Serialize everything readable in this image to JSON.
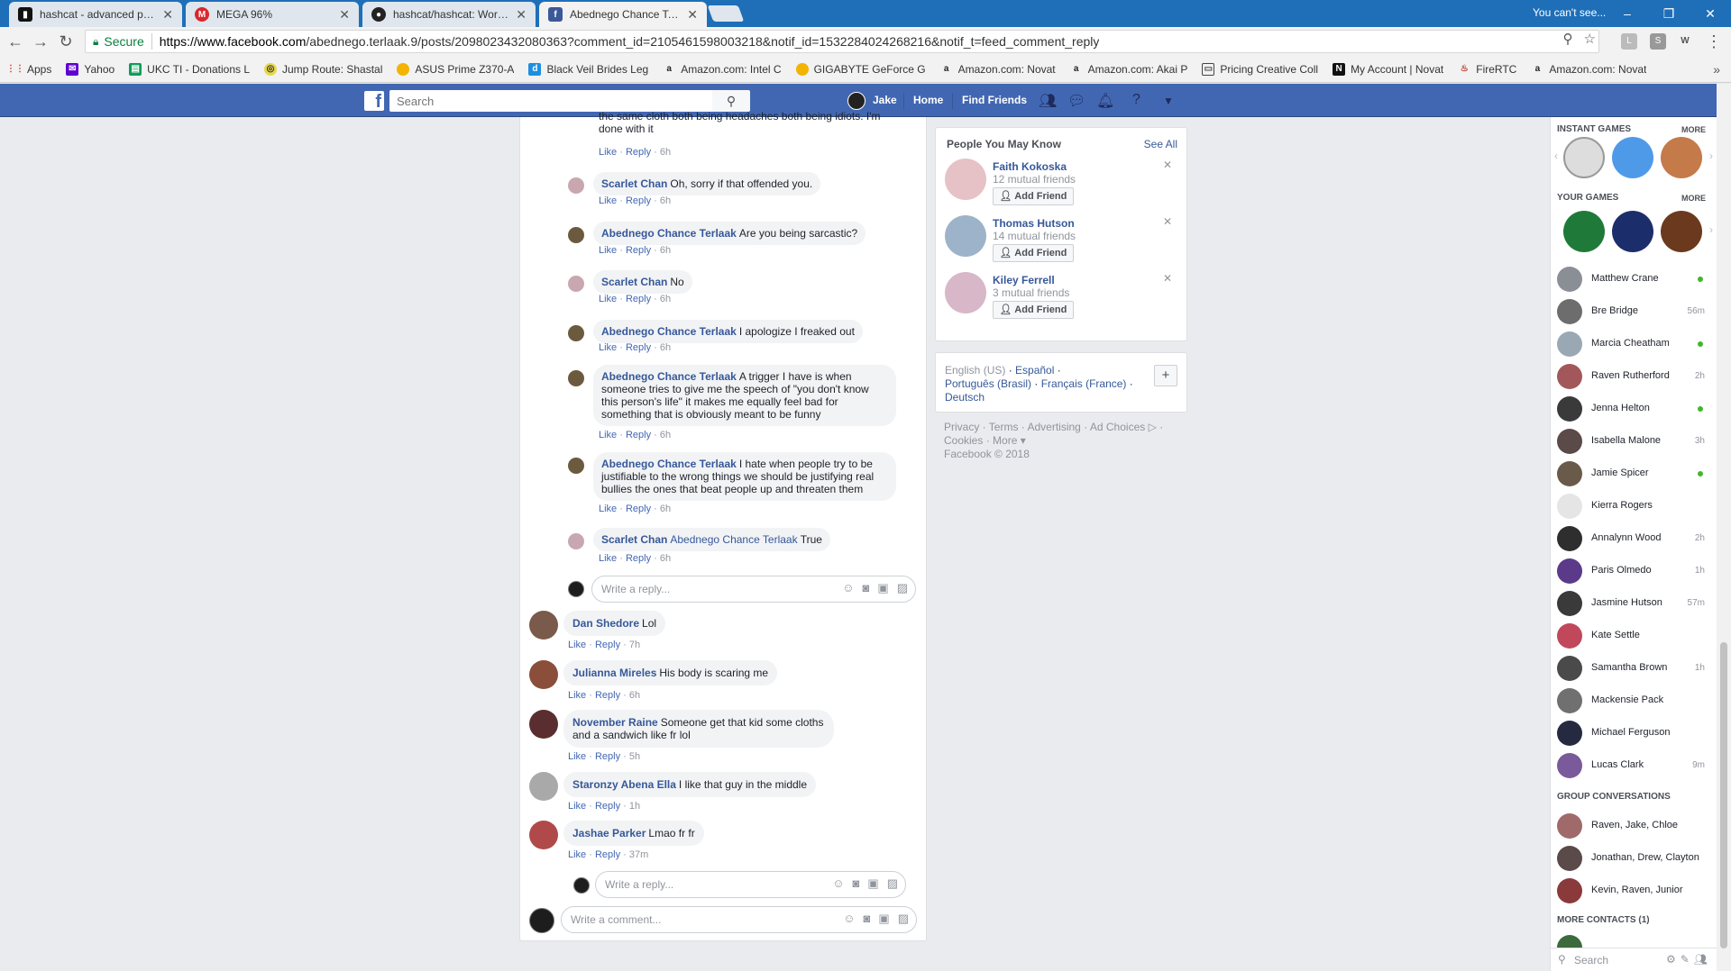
{
  "browser": {
    "tabs": [
      {
        "title": "hashcat - advanced passw",
        "favicon": "hashcat-icon",
        "active": false
      },
      {
        "title": "MEGA 96%",
        "favicon": "mega-icon",
        "active": false
      },
      {
        "title": "hashcat/hashcat: World's",
        "favicon": "github-icon",
        "active": false
      },
      {
        "title": "Abednego Chance Terlaa",
        "favicon": "facebook-icon",
        "active": true
      }
    ],
    "profile_label": "You can't see...",
    "secure_label": "Secure",
    "url_host": "https://www.facebook.com",
    "url_path": "/abednego.terlaak.9/posts/2098023432080363?comment_id=2105461598003218&notif_id=1532284024268216&notif_t=feed_comment_reply",
    "bookmarks": [
      {
        "label": "Apps",
        "icon": "apps-grid-icon",
        "color": "#d93025"
      },
      {
        "label": "Yahoo",
        "icon": "mail-icon",
        "color": "#6001d2"
      },
      {
        "label": "UKC TI - Donations L",
        "icon": "sheet-icon",
        "color": "#0f9d58"
      },
      {
        "label": "Jump Route: Shastal",
        "icon": "route-icon",
        "color": "#b5a600"
      },
      {
        "label": "ASUS Prime Z370-A",
        "icon": "coin-icon",
        "color": "#f2b400"
      },
      {
        "label": "Black Veil Brides Leg",
        "icon": "d-icon",
        "color": "#1d8fe1"
      },
      {
        "label": "Amazon.com: Intel C",
        "icon": "amazon-icon",
        "color": "#222222"
      },
      {
        "label": "GIGABYTE GeForce G",
        "icon": "coin-icon",
        "color": "#f2b400"
      },
      {
        "label": "Amazon.com: Novat",
        "icon": "amazon-icon",
        "color": "#222222"
      },
      {
        "label": "Amazon.com: Akai P",
        "icon": "amazon-icon",
        "color": "#222222"
      },
      {
        "label": "Pricing Creative Coll",
        "icon": "card-icon",
        "color": "#444444"
      },
      {
        "label": "My Account | Novat",
        "icon": "novatel-icon",
        "color": "#111111"
      },
      {
        "label": "FireRTC",
        "icon": "fire-icon",
        "color": "#c0392b"
      },
      {
        "label": "Amazon.com: Novat",
        "icon": "amazon-icon",
        "color": "#222222"
      }
    ]
  },
  "fb": {
    "search_placeholder": "Search",
    "user_name": "Jake",
    "nav_home": "Home",
    "nav_find_friends": "Find Friends"
  },
  "thread": {
    "truncated_text": "the same cloth both being headaches both being idiots. I'm done with it",
    "truncated_actions": {
      "like": "Like",
      "reply": "Reply",
      "time": "6h"
    },
    "replies": [
      {
        "author": "Scarlet Chan",
        "text": "Oh, sorry if that offended you.",
        "like": "Like",
        "reply": "Reply",
        "time": "6h"
      },
      {
        "author": "Abednego Chance Terlaak",
        "text": "Are you being sarcastic?",
        "like": "Like",
        "reply": "Reply",
        "time": "6h"
      },
      {
        "author": "Scarlet Chan",
        "text": "No",
        "like": "Like",
        "reply": "Reply",
        "time": "6h"
      },
      {
        "author": "Abednego Chance Terlaak",
        "text": "I apologize I freaked out",
        "like": "Like",
        "reply": "Reply",
        "time": "6h"
      },
      {
        "author": "Abednego Chance Terlaak",
        "text": "A trigger I have is when someone tries to give me the speech of \"you don't know this person's life\" it makes me equally feel bad for something that is obviously meant to be funny",
        "like": "Like",
        "reply": "Reply",
        "time": "6h"
      },
      {
        "author": "Abednego Chance Terlaak",
        "text": "I hate when people try to be justifiable to the wrong things we should be justifying real bullies the ones that beat people up and threaten them",
        "like": "Like",
        "reply": "Reply",
        "time": "6h"
      },
      {
        "author": "Scarlet Chan",
        "mention": "Abednego Chance Terlaak",
        "text": "True",
        "like": "Like",
        "reply": "Reply",
        "time": "6h"
      }
    ],
    "reply_placeholder": "Write a reply...",
    "comments": [
      {
        "author": "Dan Shedore",
        "text": "Lol",
        "like": "Like",
        "reply": "Reply",
        "time": "7h"
      },
      {
        "author": "Julianna Mireles",
        "text": "His body is scaring me",
        "like": "Like",
        "reply": "Reply",
        "time": "6h"
      },
      {
        "author": "November Raine",
        "text": "Someone get that kid some cloths and a sandwich like fr lol",
        "like": "Like",
        "reply": "Reply",
        "time": "5h"
      },
      {
        "author": "Staronzy Abena Ella",
        "text": "I like that guy in the middle",
        "like": "Like",
        "reply": "Reply",
        "time": "1h"
      },
      {
        "author": "Jashae Parker",
        "text": "Lmao fr fr",
        "like": "Like",
        "reply": "Reply",
        "time": "37m"
      }
    ],
    "reply_placeholder_2": "Write a reply...",
    "comment_placeholder": "Write a comment..."
  },
  "pymk": {
    "title": "People You May Know",
    "see_all": "See All",
    "people": [
      {
        "name": "Faith Kokoska",
        "mutual": "12 mutual friends",
        "button": "Add Friend"
      },
      {
        "name": "Thomas Hutson",
        "mutual": "14 mutual friends",
        "button": "Add Friend"
      },
      {
        "name": "Kiley Ferrell",
        "mutual": "3 mutual friends",
        "button": "Add Friend"
      }
    ]
  },
  "languages": {
    "current": "English (US)",
    "espanol": "Español",
    "portugues": "Português (Brasil)",
    "francais": "Français (France)",
    "deutsch": "Deutsch"
  },
  "footer": {
    "privacy": "Privacy",
    "terms": "Terms",
    "advertising": "Advertising",
    "ad_choices": "Ad Choices",
    "cookies": "Cookies",
    "more": "More",
    "copyright": "Facebook © 2018"
  },
  "chat": {
    "instant_games": "INSTANT GAMES",
    "your_games": "YOUR GAMES",
    "more": "MORE",
    "contacts": [
      {
        "name": "Matthew Crane",
        "status": "online"
      },
      {
        "name": "Bre Bridge",
        "status": "56m"
      },
      {
        "name": "Marcia Cheatham",
        "status": "online"
      },
      {
        "name": "Raven Rutherford",
        "status": "2h"
      },
      {
        "name": "Jenna Helton",
        "status": "online"
      },
      {
        "name": "Isabella Malone",
        "status": "3h"
      },
      {
        "name": "Jamie Spicer",
        "status": "online"
      },
      {
        "name": "Kierra Rogers",
        "status": ""
      },
      {
        "name": "Annalynn Wood",
        "status": "2h"
      },
      {
        "name": "Paris Olmedo",
        "status": "1h"
      },
      {
        "name": "Jasmine Hutson",
        "status": "57m"
      },
      {
        "name": "Kate Settle",
        "status": ""
      },
      {
        "name": "Samantha Brown",
        "status": "1h"
      },
      {
        "name": "Mackensie Pack",
        "status": ""
      },
      {
        "name": "Michael Ferguson",
        "status": ""
      },
      {
        "name": "Lucas Clark",
        "status": "9m"
      }
    ],
    "group_title": "GROUP CONVERSATIONS",
    "groups": [
      "Raven, Jake, Chloe",
      "Jonathan, Drew, Clayton",
      "Kevin, Raven, Junior"
    ],
    "more_contacts": "MORE CONTACTS (1)",
    "search_placeholder": "Search"
  }
}
